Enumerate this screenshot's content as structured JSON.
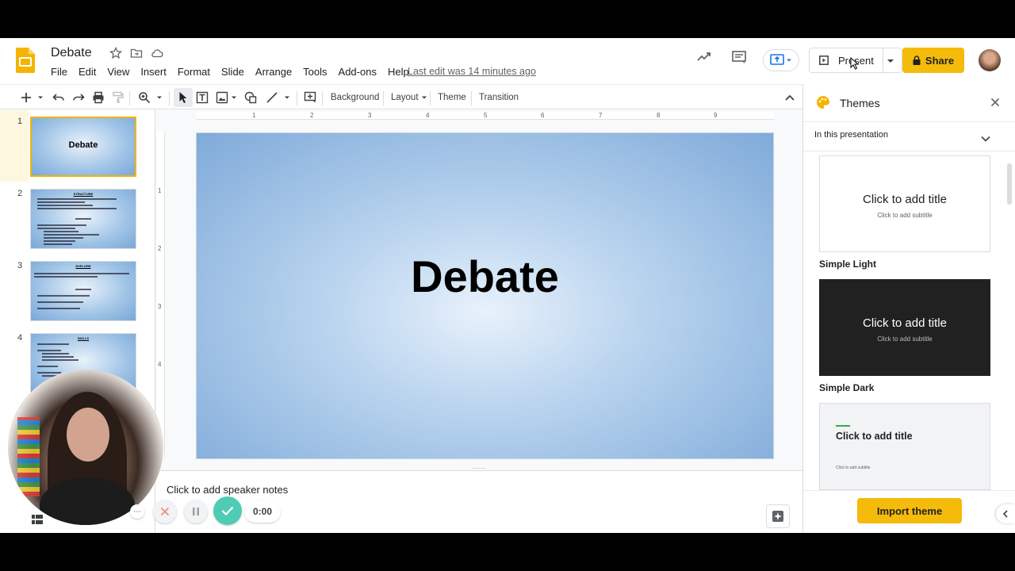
{
  "app": {
    "doc_title": "Debate",
    "last_edit": "Last edit was 14 minutes ago",
    "menu": [
      "File",
      "Edit",
      "View",
      "Insert",
      "Format",
      "Slide",
      "Arrange",
      "Tools",
      "Add-ons",
      "Help"
    ],
    "present_label": "Present",
    "share_label": "Share",
    "accent": "#f5bb0b"
  },
  "toolbar": {
    "background_label": "Background",
    "layout_label": "Layout",
    "theme_label": "Theme",
    "transition_label": "Transition"
  },
  "filmstrip": {
    "slides": [
      {
        "num": "1",
        "title": "Debate"
      },
      {
        "num": "2",
        "title": "STRUCTURE"
      },
      {
        "num": "3",
        "title": "EXPLORE"
      },
      {
        "num": "4",
        "title": "SKILLS"
      }
    ]
  },
  "ruler": {
    "h_marks": [
      "1",
      "2",
      "3",
      "4",
      "5",
      "6",
      "7",
      "8",
      "9"
    ],
    "v_marks": [
      "1",
      "2",
      "3",
      "4"
    ]
  },
  "slide": {
    "title": "Debate"
  },
  "notes": {
    "placeholder": "Click to add speaker notes"
  },
  "themes": {
    "title": "Themes",
    "filter": "In this presentation",
    "cards": [
      {
        "name": "Simple Light",
        "title": "Click to add title",
        "subtitle": "Click to add subtitle"
      },
      {
        "name": "Simple Dark",
        "title": "Click to add title",
        "subtitle": "Click to add subtitle"
      },
      {
        "name": "",
        "title": "Click to add title",
        "subtitle": "Click to add subtitle"
      }
    ],
    "import_label": "Import theme"
  },
  "recorder": {
    "time": "0:00"
  }
}
